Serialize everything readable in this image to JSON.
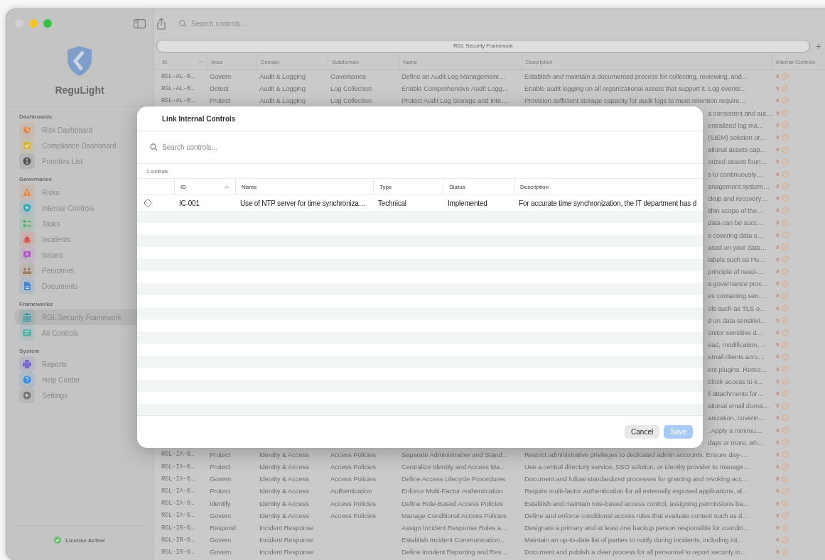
{
  "toolbar": {
    "search": {
      "placeholder": "Search controls..."
    }
  },
  "sidebar": {
    "app_name": "ReguLight",
    "sections": [
      {
        "title": "Dashboards",
        "items": [
          {
            "label": "Risk Dashboard",
            "selected": false,
            "color": "#e0894f"
          },
          {
            "label": "Compliance Dashboard",
            "selected": false,
            "color": "#d9b43c"
          },
          {
            "label": "Priorities List",
            "selected": false,
            "color": "#555555"
          }
        ]
      },
      {
        "title": "Governance",
        "items": [
          {
            "label": "Risks",
            "selected": false,
            "color": "#e0894f"
          },
          {
            "label": "Internal Controls",
            "selected": false,
            "color": "#3aa6b4"
          },
          {
            "label": "Tasks",
            "selected": false,
            "color": "#4fae66"
          },
          {
            "label": "Incidents",
            "selected": false,
            "color": "#d9574e"
          },
          {
            "label": "Issues",
            "selected": false,
            "color": "#b35cc2"
          },
          {
            "label": "Personnel",
            "selected": false,
            "color": "#9e7b5c"
          },
          {
            "label": "Documents",
            "selected": false,
            "color": "#4a86cf"
          }
        ]
      },
      {
        "title": "Frameworks",
        "items": [
          {
            "label": "RGL Security Framework",
            "selected": true,
            "color": "#2f98a4"
          },
          {
            "label": "All Controls",
            "selected": false,
            "color": "#5aafa7"
          }
        ]
      },
      {
        "title": "System",
        "items": [
          {
            "label": "Reports",
            "selected": false,
            "color": "#7a68cc"
          },
          {
            "label": "Help Center",
            "selected": false,
            "color": "#3a8bdc"
          },
          {
            "label": "Settings",
            "selected": false,
            "color": "#777777"
          }
        ]
      }
    ],
    "license": "License Active"
  },
  "framework_tab": {
    "label": "RGL Security Framework",
    "selected": true
  },
  "add_button": "+",
  "table": {
    "columns": [
      {
        "label": "ID",
        "sorted": true
      },
      {
        "label": "Area",
        "sorted": false
      },
      {
        "label": "Domain",
        "sorted": false
      },
      {
        "label": "Subdomain",
        "sorted": false
      },
      {
        "label": "Name",
        "sorted": false
      },
      {
        "label": "Description",
        "sorted": false
      },
      {
        "label": "Internal Controls",
        "sorted": false
      }
    ],
    "rows": [
      {
        "kind": "full",
        "id": "RGL-AL-0…",
        "area": "Govern",
        "domain": "Audit & Logging",
        "subdomain": "Governance",
        "name": "Define an Audit Log Management…",
        "description": "Establish and maintain a documented process for collecting, reviewing, and…",
        "internal_controls": "0"
      },
      {
        "kind": "full",
        "id": "RGL-AL-0…",
        "area": "Detect",
        "domain": "Audit & Logging",
        "subdomain": "Log Collection",
        "name": "Enable Comprehensive Audit Logg…",
        "description": "Enable audit logging on all organizational assets that support it. Log events…",
        "internal_controls": "0"
      },
      {
        "kind": "full",
        "id": "RGL-AL-0…",
        "area": "Protect",
        "domain": "Audit & Logging",
        "subdomain": "Log Collection",
        "name": "Protect Audit Log Storage and Inte…",
        "description": "Provision sufficient storage capacity for audit logs to meet retention require…",
        "internal_controls": "0"
      },
      {
        "kind": "tail",
        "description": "a consistent and aut…",
        "internal_controls": "0"
      },
      {
        "kind": "tail",
        "description": "entralized log ma…",
        "internal_controls": "0"
      },
      {
        "kind": "tail",
        "description": "(SIEM) solution or…",
        "internal_controls": "0"
      },
      {
        "kind": "tail",
        "description": "ational assets cap…",
        "internal_controls": "0"
      },
      {
        "kind": "tail",
        "description": "orized assets foun…",
        "internal_controls": "0"
      },
      {
        "kind": "tail",
        "description": "s to continuously…",
        "internal_controls": "0"
      },
      {
        "kind": "tail",
        "description": "anagement system…",
        "internal_controls": "0"
      },
      {
        "kind": "tail",
        "description": "ckup and recovery…",
        "internal_controls": "0"
      },
      {
        "kind": "tail",
        "description": "ithin scope of the…",
        "internal_controls": "0"
      },
      {
        "kind": "tail",
        "description": "data can be succ…",
        "internal_controls": "0"
      },
      {
        "kind": "tail",
        "description": "s covering data s…",
        "internal_controls": "0"
      },
      {
        "kind": "tail",
        "description": "ased on your data…",
        "internal_controls": "0"
      },
      {
        "kind": "tail",
        "description": "labels such as Pu…",
        "internal_controls": "0"
      },
      {
        "kind": "tail",
        "description": "principle of need-…",
        "internal_controls": "0"
      },
      {
        "kind": "tail",
        "description": "a governance proc…",
        "internal_controls": "0"
      },
      {
        "kind": "tail",
        "description": "es containing sen…",
        "internal_controls": "0"
      },
      {
        "kind": "tail",
        "description": "ols such as TLS o…",
        "internal_controls": "0"
      },
      {
        "kind": "tail",
        "description": "d on data sensitivi…",
        "internal_controls": "0"
      },
      {
        "kind": "tail",
        "description": "onitor sensitive d…",
        "internal_controls": "0"
      },
      {
        "kind": "tail",
        "description": "ead, modification,…",
        "internal_controls": "0"
      },
      {
        "kind": "tail",
        "description": "email clients acro…",
        "internal_controls": "0"
      },
      {
        "kind": "tail",
        "description": "ent plugins. Remo…",
        "internal_controls": "0"
      },
      {
        "kind": "tail",
        "description": "block access to k…",
        "internal_controls": "0"
      },
      {
        "kind": "tail",
        "description": "il attachments for…",
        "internal_controls": "0"
      },
      {
        "kind": "tail",
        "description": "ational email doma…",
        "internal_controls": "0"
      },
      {
        "kind": "tail",
        "description": "anization, coverin…",
        "internal_controls": "0"
      },
      {
        "kind": "tail",
        "description": ". Apply a minimu…",
        "internal_controls": "0"
      },
      {
        "kind": "tail",
        "description": "days or more, wh…",
        "internal_controls": "0"
      },
      {
        "kind": "full",
        "id": "RGL-IA-0…",
        "area": "Protect",
        "domain": "Identity & Access",
        "subdomain": "Access Policies",
        "name": "Separate Administrative and Stand…",
        "description": "Restrict administrative privileges to dedicated admin accounts. Ensure day-…",
        "internal_controls": "0"
      },
      {
        "kind": "full",
        "id": "RGL-IA-0…",
        "area": "Protect",
        "domain": "Identity & Access",
        "subdomain": "Access Policies",
        "name": "Centralize Identity and Access Ma…",
        "description": "Use a central directory service, SSO solution, or identity provider to manage…",
        "internal_controls": "0"
      },
      {
        "kind": "full",
        "id": "RGL-IA-0…",
        "area": "Govern",
        "domain": "Identity & Access",
        "subdomain": "Access Policies",
        "name": "Define Access Lifecycle Procedures",
        "description": "Document and follow standardized processes for granting and revoking acc…",
        "internal_controls": "0"
      },
      {
        "kind": "full",
        "id": "RGL-IA-0…",
        "area": "Protect",
        "domain": "Identity & Access",
        "subdomain": "Authentication",
        "name": "Enforce Multi-Factor Authentication",
        "description": "Require multi-factor authentication for all externally exposed applications, al…",
        "internal_controls": "0"
      },
      {
        "kind": "full",
        "id": "RGL-IA-0…",
        "area": "Identify",
        "domain": "Identity & Access",
        "subdomain": "Access Policies",
        "name": "Define Role-Based Access Policies",
        "description": "Establish and maintain role-based access control, assigning permissions ba…",
        "internal_controls": "0"
      },
      {
        "kind": "full",
        "id": "RGL-IA-0…",
        "area": "Govern",
        "domain": "Identity & Access",
        "subdomain": "Access Policies",
        "name": "Manage Conditional Access Policies",
        "description": "Define and enforce conditional access rules that evaluate context such as d…",
        "internal_controls": "0"
      },
      {
        "kind": "full",
        "id": "RGL-IR-0…",
        "area": "Respond",
        "domain": "Incident Response",
        "name": "Assign Incident Response Roles a…",
        "description": "Designate a primary and at least one backup person responsible for coordin…",
        "internal_controls": "0"
      },
      {
        "kind": "full",
        "id": "RGL-IR-0…",
        "area": "Govern",
        "domain": "Incident Response",
        "name": "Establish Incident Communication…",
        "description": "Maintain an up-to-date list of parties to notify during incidents, including int…",
        "internal_controls": "0"
      },
      {
        "kind": "full",
        "id": "RGL-IR-0…",
        "area": "Govern",
        "domain": "Incident Response",
        "name": "Define Incident Reporting and Res…",
        "description": "Document and publish a clear process for all personnel to report security in…",
        "internal_controls": "0"
      }
    ]
  },
  "dialog": {
    "title": "Link Internal Controls",
    "search": {
      "placeholder": "Search controls..."
    },
    "count": "1 controls",
    "columns": [
      {
        "label": "ID",
        "sorted": true
      },
      {
        "label": "Name",
        "sorted": false
      },
      {
        "label": "Type",
        "sorted": false
      },
      {
        "label": "Status",
        "sorted": false
      },
      {
        "label": "Description",
        "sorted": false
      }
    ],
    "rows": [
      {
        "selected": false,
        "id": "IC-001",
        "name": "Use of NTP server for time synchroniza…",
        "type": "Technical",
        "status": "Implemented",
        "description": "For accurate time synchronization, the IT department has d"
      }
    ],
    "buttons": [
      {
        "label": "Cancel",
        "kind": "secondary",
        "disabled": false
      },
      {
        "label": "Save",
        "kind": "primary",
        "disabled": true
      }
    ]
  }
}
